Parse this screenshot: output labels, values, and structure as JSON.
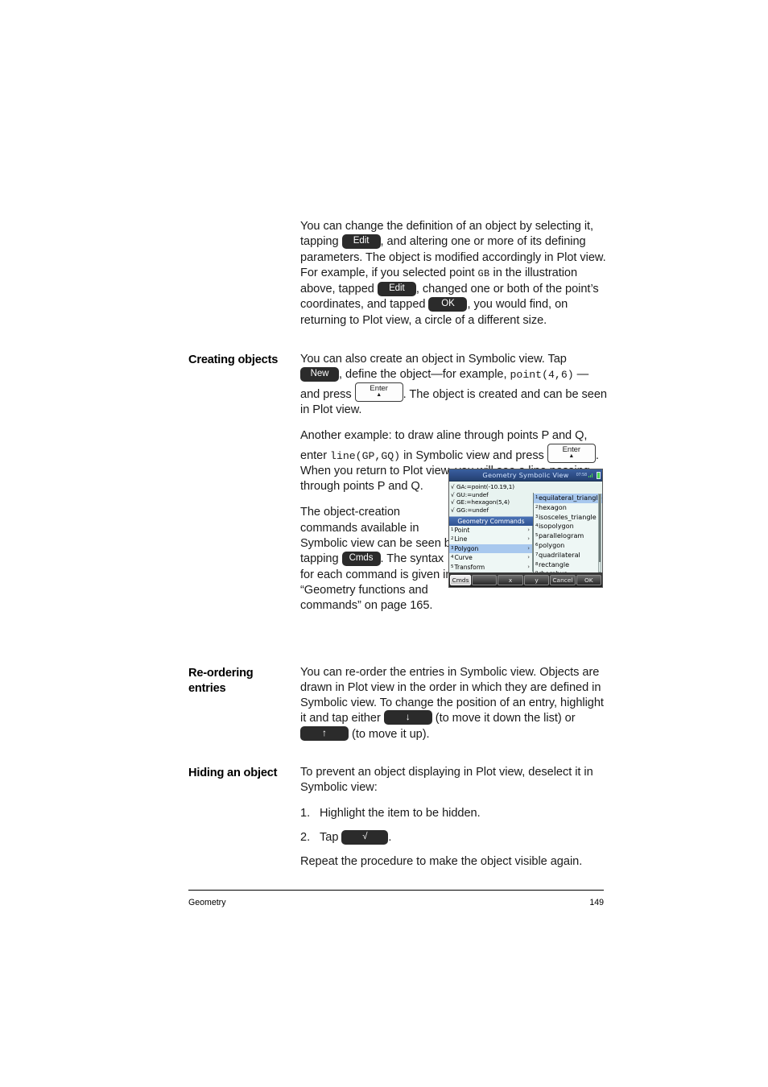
{
  "page": {
    "footer_left": "Geometry",
    "footer_right": "149"
  },
  "sections": [
    {
      "heading": "",
      "paragraphs": [
        {
          "parts": [
            {
              "t": "text",
              "v": "You can change the definition of an object by selecting it, tapping "
            },
            {
              "t": "keydark",
              "v": "Edit"
            },
            {
              "t": "text",
              "v": ", and altering one or more of its defining parameters. The object is modified accordingly in Plot view. For example, if you selected point "
            },
            {
              "t": "smallcaps",
              "v": "GB"
            },
            {
              "t": "text",
              "v": " in the illustration above, tapped "
            },
            {
              "t": "keydark",
              "v": "Edit"
            },
            {
              "t": "text",
              "v": ", changed one or both of the point’s coordinates, and tapped "
            },
            {
              "t": "keydark",
              "v": "OK"
            },
            {
              "t": "text",
              "v": ", you would find, on returning to Plot view, a circle of a different size."
            }
          ]
        }
      ]
    }
  ],
  "creating_objects": {
    "heading": "Creating objects",
    "p1_a": "You can also create an object in Symbolic view. Tap ",
    "p1_new": "New",
    "p1_b": ", define the object—for example, ",
    "p1_code": "point(4,6)",
    "p1_c": " —and press ",
    "p1_enter": "Enter",
    "p1_d": ". The object is created and can be seen in Plot view.",
    "p2_a": "Another example: to draw aline through points P and Q, enter ",
    "p2_code": "line(GP,GQ)",
    "p2_b": " in Symbolic view and press ",
    "p2_enter": "Enter",
    "p2_c": ". When you return to Plot view, you will see a line passing through points P and Q.",
    "p3_a": "The object-creation commands available in Symbolic view can be seen by tapping ",
    "p3_cmds": "Cmds",
    "p3_b": ". The syntax for each command is given in “Geometry functions and commands” on page 165."
  },
  "reordering": {
    "heading_line1": "Re-ordering",
    "heading_line2": "entries",
    "p_a": "You can re-order the entries in Symbolic view. Objects are drawn in Plot view in the order in which they are defined in Symbolic view. To change the position of an entry, highlight it and tap either ",
    "key_down": "↓",
    "p_b": " (to move it down the list) or ",
    "key_up": "↑",
    "p_c": " (to move it up)."
  },
  "hiding": {
    "heading": "Hiding an object",
    "p_intro": "To prevent an object displaying in Plot view, deselect it in Symbolic view:",
    "step1_num": "1.",
    "step1_text": "Highlight the item to be hidden.",
    "step2_num": "2.",
    "step2_text_a": "Tap ",
    "step2_key": "√",
    "step2_text_b": ".",
    "p_repeat": "Repeat the procedure to make the object visible again."
  },
  "calculator": {
    "title": "Geometry Symbolic View",
    "clock": "07:58",
    "symbolic_entries": [
      {
        "check": "√",
        "text": "GA:=point(-10.19,1)"
      },
      {
        "check": "√",
        "text": "GU:=undef"
      },
      {
        "check": "√",
        "text": "GE:=hexagon(5,4)"
      },
      {
        "check": "√",
        "text": "GG:=undef"
      }
    ],
    "commands_header": "Geometry Commands",
    "commands": [
      {
        "index": "1",
        "label": "Point",
        "selected": false
      },
      {
        "index": "2",
        "label": "Line",
        "selected": false
      },
      {
        "index": "3",
        "label": "Polygon",
        "selected": true
      },
      {
        "index": "4",
        "label": "Curve",
        "selected": false
      },
      {
        "index": "5",
        "label": "Transform",
        "selected": false
      }
    ],
    "subcommands": [
      {
        "index": "1",
        "label": "equilateral_triangle",
        "selected": true
      },
      {
        "index": "2",
        "label": "hexagon",
        "selected": false
      },
      {
        "index": "3",
        "label": "isosceles_triangle",
        "selected": false
      },
      {
        "index": "4",
        "label": "isopolygon",
        "selected": false
      },
      {
        "index": "5",
        "label": "parallelogram",
        "selected": false
      },
      {
        "index": "6",
        "label": "polygon",
        "selected": false
      },
      {
        "index": "7",
        "label": "quadrilateral",
        "selected": false
      },
      {
        "index": "8",
        "label": "rectangle",
        "selected": false
      },
      {
        "index": "9",
        "label": "rhombus",
        "selected": false
      }
    ],
    "footer_buttons": [
      {
        "label": "Cmds",
        "style": "first"
      },
      {
        "label": "",
        "style": "blank"
      },
      {
        "label": "x",
        "style": "normal"
      },
      {
        "label": "y",
        "style": "normal"
      },
      {
        "label": "Cancel",
        "style": "normal"
      },
      {
        "label": "OK",
        "style": "normal"
      }
    ]
  }
}
